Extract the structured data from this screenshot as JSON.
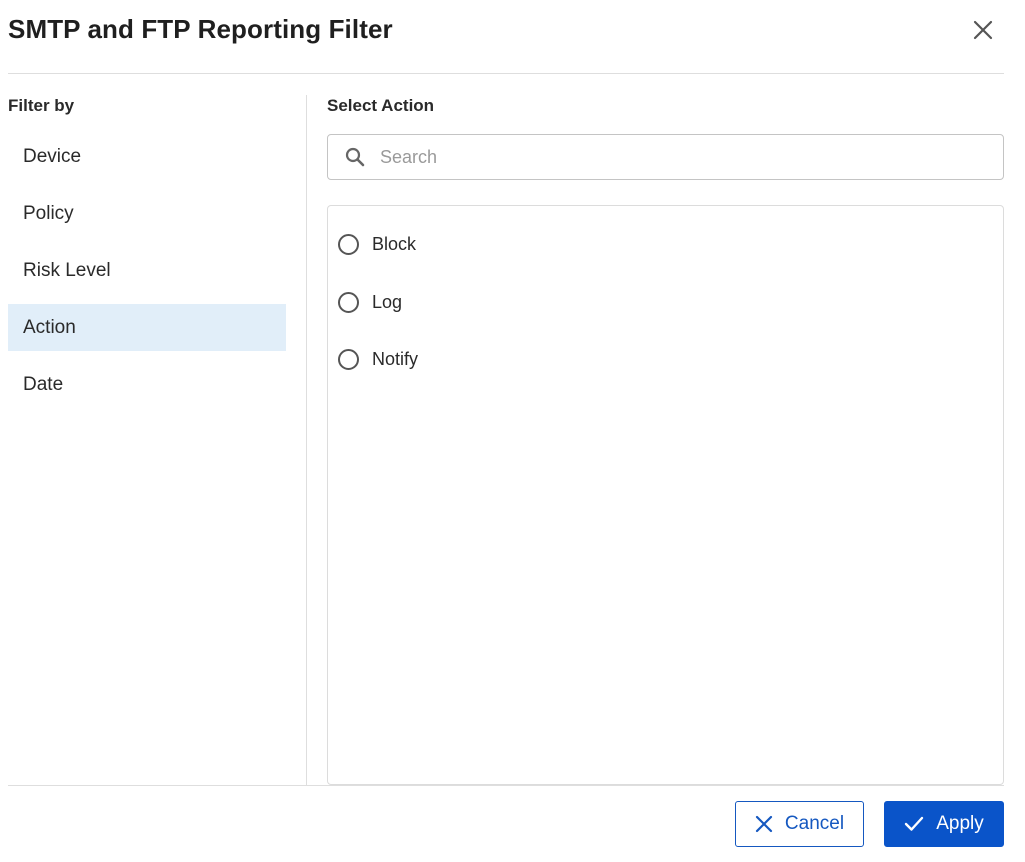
{
  "dialog": {
    "title": "SMTP and FTP Reporting Filter",
    "close_icon": "close-icon"
  },
  "sidebar": {
    "heading": "Filter by",
    "items": [
      {
        "label": "Device",
        "active": false
      },
      {
        "label": "Policy",
        "active": false
      },
      {
        "label": "Risk Level",
        "active": false
      },
      {
        "label": "Action",
        "active": true
      },
      {
        "label": "Date",
        "active": false
      }
    ]
  },
  "main": {
    "heading": "Select Action",
    "search": {
      "placeholder": "Search",
      "value": "",
      "icon": "search-icon"
    },
    "options": [
      {
        "label": "Block",
        "selected": false
      },
      {
        "label": "Log",
        "selected": false
      },
      {
        "label": "Notify",
        "selected": false
      }
    ]
  },
  "footer": {
    "cancel_label": "Cancel",
    "apply_label": "Apply"
  },
  "colors": {
    "accent": "#0a54c9",
    "active_item_bg": "#e1eef9",
    "divider": "#dedede"
  }
}
